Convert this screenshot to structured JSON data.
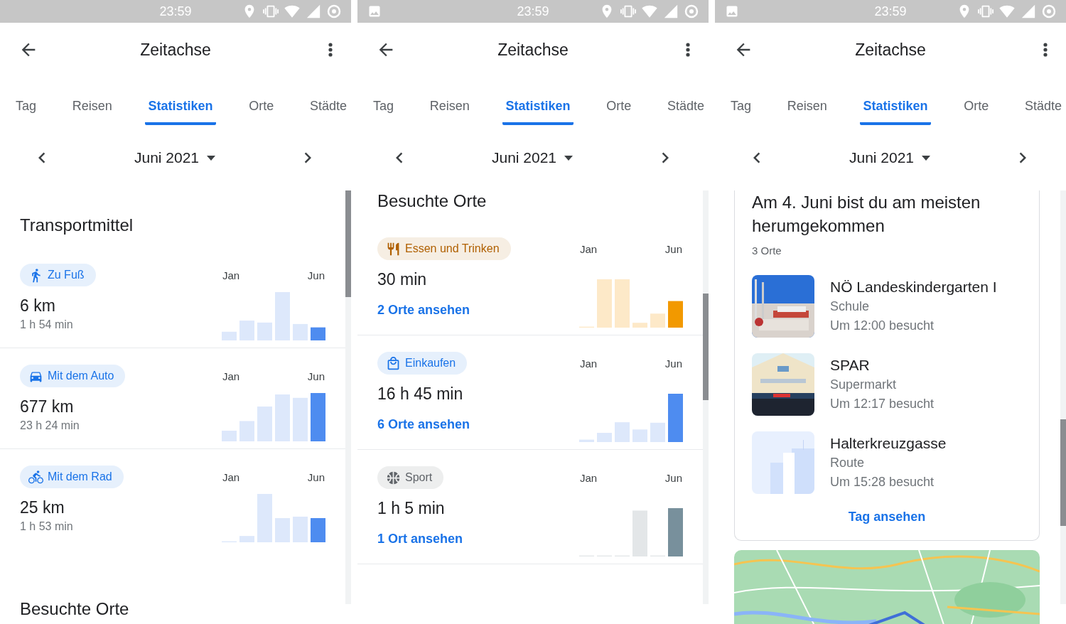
{
  "screens": [
    {
      "kind": "transport",
      "status_bar": {
        "time": "23:59",
        "image_notification": false
      },
      "app_bar": {
        "title": "Zeitachse"
      },
      "tabs": [
        {
          "label": "Tag",
          "selected": false
        },
        {
          "label": "Reisen",
          "selected": false
        },
        {
          "label": "Statistiken",
          "selected": true
        },
        {
          "label": "Orte",
          "selected": false
        },
        {
          "label": "Städte",
          "selected": false
        }
      ],
      "month": "Juni 2021",
      "heading": "Transportmittel",
      "items": [
        {
          "label": "Zu Fuß",
          "color": "#1a73e8",
          "value": "6 km",
          "detail": "1 h 54 min",
          "chart_start": "Jan",
          "chart_end": "Jun"
        },
        {
          "label": "Mit dem Auto",
          "color": "#1a73e8",
          "value": "677 km",
          "detail": "23 h 24 min",
          "chart_start": "Jan",
          "chart_end": "Jun"
        },
        {
          "label": "Mit dem Rad",
          "color": "#1a73e8",
          "value": "25 km",
          "detail": "1 h 53 min",
          "chart_start": "Jan",
          "chart_end": "Jun"
        }
      ],
      "next_heading": "Besuchte Orte"
    },
    {
      "kind": "places",
      "status_bar": {
        "time": "23:59",
        "image_notification": true
      },
      "app_bar": {
        "title": "Zeitachse"
      },
      "tabs": [
        {
          "label": "Tag",
          "selected": false
        },
        {
          "label": "Reisen",
          "selected": false
        },
        {
          "label": "Statistiken",
          "selected": true
        },
        {
          "label": "Orte",
          "selected": false
        },
        {
          "label": "Städte",
          "selected": false
        }
      ],
      "month": "Juni 2021",
      "heading": "Besuchte Orte",
      "items": [
        {
          "label": "Essen und Trinken",
          "color": "#b06000",
          "value": "30 min",
          "link": "2 Orte ansehen",
          "chart_start": "Jan",
          "chart_end": "Jun"
        },
        {
          "label": "Einkaufen",
          "color": "#1a73e8",
          "value": "16 h 45 min",
          "link": "6 Orte ansehen",
          "chart_start": "Jan",
          "chart_end": "Jun"
        },
        {
          "label": "Sport",
          "color": "#5f6368",
          "value": "1 h 5 min",
          "link": "1 Ort ansehen",
          "chart_start": "Jan",
          "chart_end": "Jun"
        }
      ]
    },
    {
      "kind": "day",
      "status_bar": {
        "time": "23:59",
        "image_notification": true
      },
      "app_bar": {
        "title": "Zeitachse"
      },
      "tabs": [
        {
          "label": "Tag",
          "selected": false
        },
        {
          "label": "Reisen",
          "selected": false
        },
        {
          "label": "Statistiken",
          "selected": true
        },
        {
          "label": "Orte",
          "selected": false
        },
        {
          "label": "Städte",
          "selected": false
        }
      ],
      "month": "Juni 2021",
      "card": {
        "title": "Am 4. Juni bist du am meisten herumgekommen",
        "count": "3 Orte",
        "places": [
          {
            "name": "NÖ Landeskindergarten I",
            "category": "Schule",
            "visit": "Um 12:00 besucht"
          },
          {
            "name": "SPAR",
            "category": "Supermarkt",
            "visit": "Um 12:17 besucht"
          },
          {
            "name": "Halterkreuzgasse",
            "category": "Route",
            "visit": "Um 15:28 besucht"
          }
        ],
        "link": "Tag ansehen"
      }
    }
  ]
}
